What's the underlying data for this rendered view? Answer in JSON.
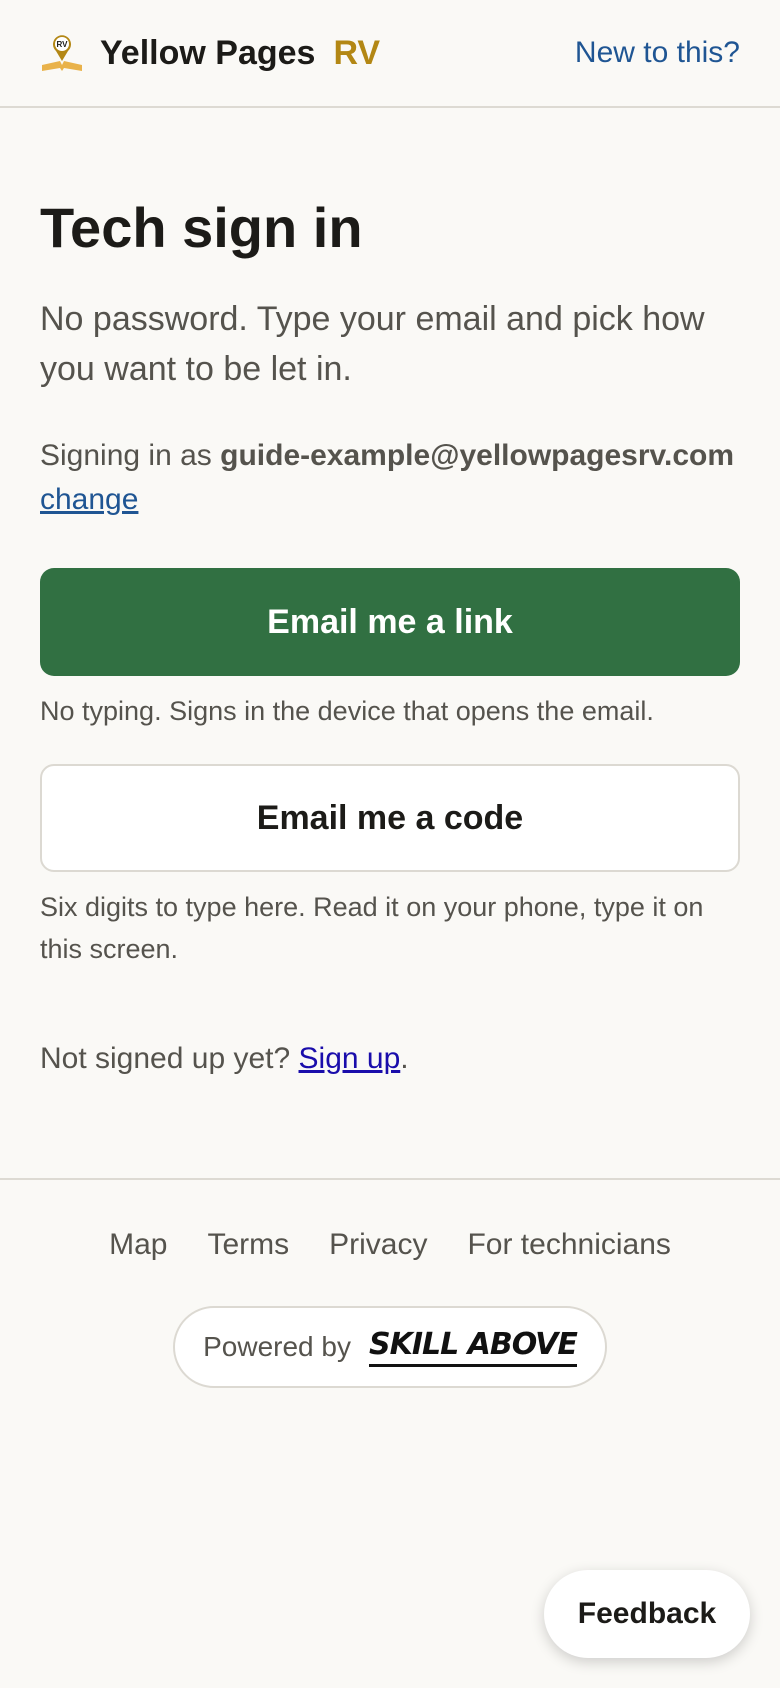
{
  "header": {
    "logo_icon": "rv-pin-book-icon",
    "logo_badge": "RV",
    "brand_name": "Yellow Pages",
    "brand_suffix": "RV",
    "new_link": "New to this?"
  },
  "main": {
    "title": "Tech sign in",
    "lede": "No password. Type your email and pick how you want to be let in.",
    "signing_prefix": "Signing in as",
    "email": "guide-example@yellowpagesrv.com",
    "change_link": "change",
    "link_button": "Email me a link",
    "link_hint": "No typing. Signs in the device that opens the email.",
    "code_button": "Email me a code",
    "code_hint": "Six digits to type here. Read it on your phone, type it on this screen.",
    "signup_prefix": "Not signed up yet?",
    "signup_link": "Sign up",
    "signup_suffix": "."
  },
  "footer": {
    "links": [
      "Map",
      "Terms",
      "Privacy",
      "For technicians"
    ],
    "powered_by": "Powered by",
    "powered_logo": "SKILL ABOVE"
  },
  "feedback": "Feedback",
  "colors": {
    "background": "#faf9f6",
    "accent_green": "#317042",
    "brand_gold": "#b38714",
    "link_blue": "#1f5593"
  }
}
